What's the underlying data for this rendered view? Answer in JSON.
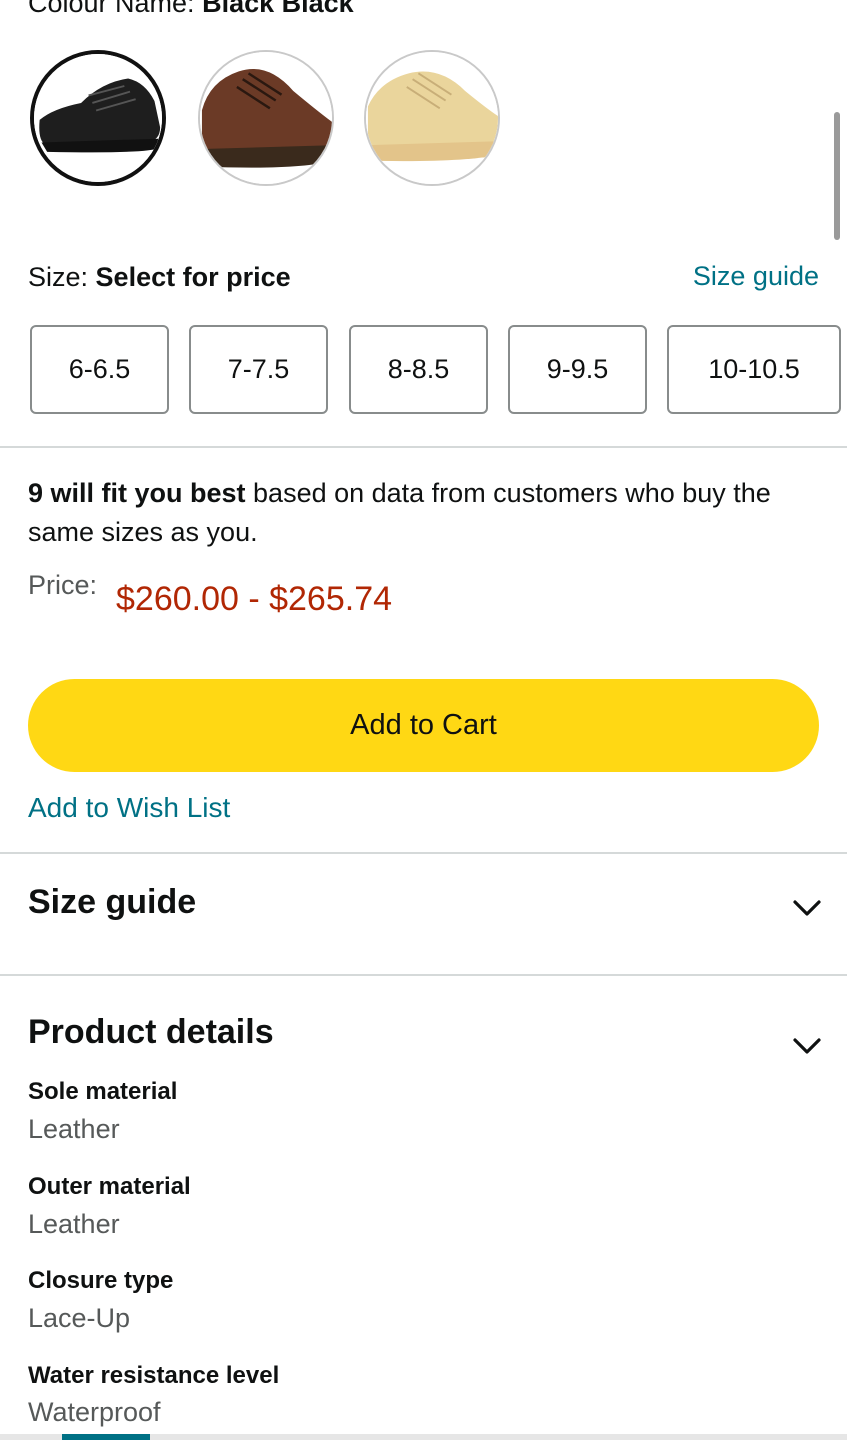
{
  "colour": {
    "label": "Colour Name:",
    "value": "Black Black"
  },
  "swatches": [
    {
      "name": "Black",
      "selected": true,
      "color": "#1e1e1e"
    },
    {
      "name": "Brown",
      "selected": false,
      "color": "#6b3a26"
    },
    {
      "name": "Beige",
      "selected": false,
      "color": "#ead59c"
    }
  ],
  "size": {
    "label": "Size:",
    "value": "Select for price",
    "guide_link": "Size guide",
    "options": [
      "6-6.5",
      "7-7.5",
      "8-8.5",
      "9-9.5",
      "10-10.5"
    ]
  },
  "fit": {
    "bold": "9 will fit you best",
    "rest": " based on data from customers who buy the same sizes as you."
  },
  "price": {
    "label": "Price:",
    "value": "$260.00 - $265.74"
  },
  "actions": {
    "add_to_cart": "Add to Cart",
    "add_to_wishlist": "Add to Wish List"
  },
  "sections": {
    "size_guide": "Size guide",
    "product_details": "Product details"
  },
  "details": [
    {
      "label": "Sole material",
      "value": "Leather"
    },
    {
      "label": "Outer material",
      "value": "Leather"
    },
    {
      "label": "Closure type",
      "value": "Lace-Up"
    },
    {
      "label": "Water resistance level",
      "value": "Waterproof"
    }
  ],
  "colors": {
    "accent_link": "#007185",
    "price": "#b12704",
    "cart_button": "#ffd814"
  }
}
